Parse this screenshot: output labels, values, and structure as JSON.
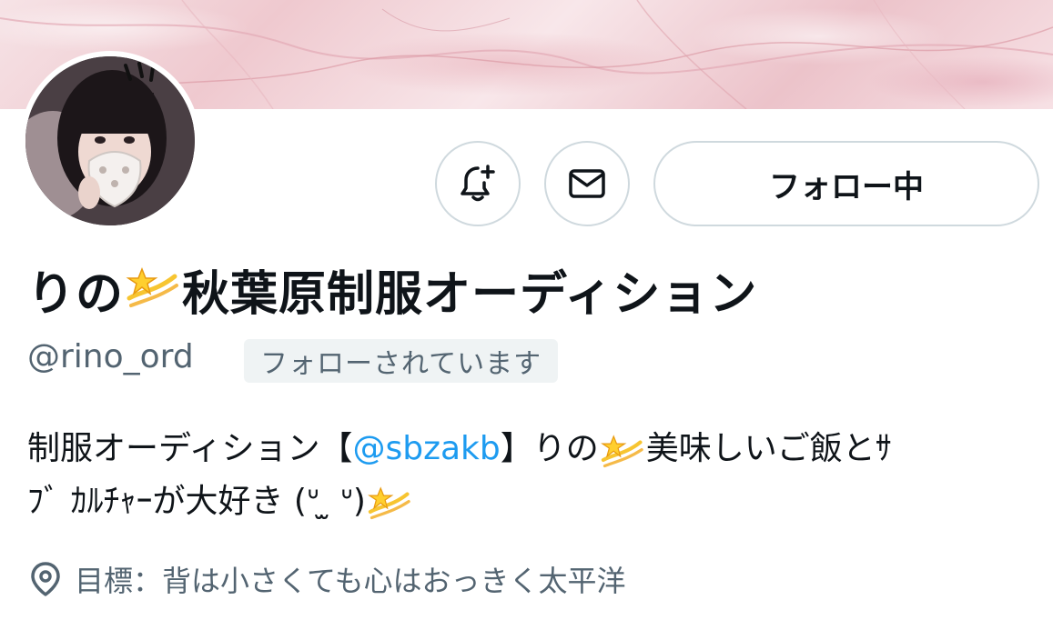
{
  "profile": {
    "display_name_prefix": "りの",
    "display_name_suffix": "秋葉原制服オーディション",
    "handle": "@rino_ord",
    "follows_you_label": "フォローされています"
  },
  "actions": {
    "follow_label": "フォロー中"
  },
  "bio": {
    "part1": "制服オーディション【",
    "mention": "@sbzakb",
    "part2": "】りの",
    "part3": "美味しいご飯とｻﾌﾞｶﾙﾁｬｰが大好き (ᐡ ̳ᴗ ̫ ᴗ ̳ᐡ)",
    "part3_line1": "美味しいご飯とｻ",
    "part3_line2": "ﾌﾞ ｶﾙﾁｬｰが大好き (ᐡ ̫ ᐡ)"
  },
  "location": {
    "text": "目標：背は小さくても心はおっきく太平洋"
  },
  "icons": {
    "notify": "bell-plus-icon",
    "message": "envelope-icon",
    "location": "map-pin-icon",
    "emoji": "dizzy-star-emoji"
  },
  "colors": {
    "text_primary": "#0f1419",
    "text_secondary": "#536471",
    "link": "#1d9bf0",
    "border": "#cfd9de",
    "badge_bg": "#eff3f4"
  }
}
